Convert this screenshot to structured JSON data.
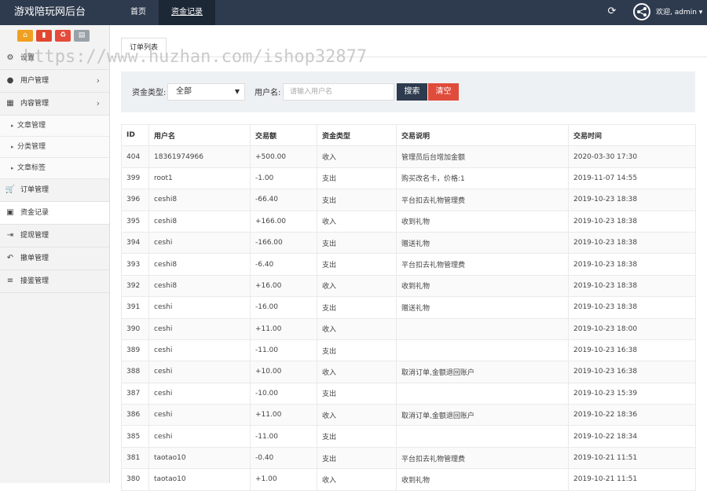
{
  "app": {
    "title": "游戏陪玩网后台"
  },
  "topnav": [
    {
      "label": "首页",
      "active": false
    },
    {
      "label": "资金记录",
      "active": true
    }
  ],
  "header": {
    "refresh_icon": "refresh-icon",
    "welcome": "欢迎, admin ▾"
  },
  "sidebar": {
    "tools": [
      {
        "icon": "home-icon",
        "color": "#f0a020"
      },
      {
        "icon": "trash-icon",
        "color": "#e04830"
      },
      {
        "icon": "recycle-icon",
        "color": "#e64a3b"
      },
      {
        "icon": "list-icon",
        "color": "#9aa2a8"
      }
    ],
    "items": [
      {
        "label": "设置",
        "icon": "gear-icon"
      },
      {
        "label": "用户管理",
        "icon": "users-icon"
      },
      {
        "label": "内容管理",
        "icon": "grid-icon"
      },
      {
        "label": "文章管理"
      },
      {
        "label": "分类管理"
      },
      {
        "label": "文章标签"
      },
      {
        "label": "订单管理",
        "icon": "cart-icon"
      },
      {
        "label": "资金记录",
        "icon": "money-icon"
      },
      {
        "label": "提现管理",
        "icon": "export-icon"
      },
      {
        "label": "撤单管理",
        "icon": "undo-icon"
      },
      {
        "label": "接鉴管理",
        "icon": "menu-icon"
      }
    ]
  },
  "watermark": "https://www.huzhan.com/ishop32877",
  "tab": {
    "label": "订单列表"
  },
  "filter": {
    "type_label": "资金类型:",
    "type_value": "全部",
    "user_label": "用户名:",
    "user_placeholder": "请输入用户名",
    "search_label": "搜索",
    "clear_label": "清空"
  },
  "table": {
    "headers": [
      "ID",
      "用户名",
      "交易额",
      "资金类型",
      "交易说明",
      "交易时间"
    ],
    "rows": [
      [
        "404",
        "18361974966",
        "+500.00",
        "收入",
        "管理员后台增加金额",
        "2020-03-30 17:30"
      ],
      [
        "399",
        "root1",
        "-1.00",
        "支出",
        "购买改名卡，价格:1",
        "2019-11-07 14:55"
      ],
      [
        "396",
        "ceshi8",
        "-66.40",
        "支出",
        "平台扣去礼物管理费",
        "2019-10-23 18:38"
      ],
      [
        "395",
        "ceshi8",
        "+166.00",
        "收入",
        "收到礼物",
        "2019-10-23 18:38"
      ],
      [
        "394",
        "ceshi",
        "-166.00",
        "支出",
        "赠送礼物",
        "2019-10-23 18:38"
      ],
      [
        "393",
        "ceshi8",
        "-6.40",
        "支出",
        "平台扣去礼物管理费",
        "2019-10-23 18:38"
      ],
      [
        "392",
        "ceshi8",
        "+16.00",
        "收入",
        "收到礼物",
        "2019-10-23 18:38"
      ],
      [
        "391",
        "ceshi",
        "-16.00",
        "支出",
        "赠送礼物",
        "2019-10-23 18:38"
      ],
      [
        "390",
        "ceshi",
        "+11.00",
        "收入",
        "",
        "2019-10-23 18:00"
      ],
      [
        "389",
        "ceshi",
        "-11.00",
        "支出",
        "",
        "2019-10-23 16:38"
      ],
      [
        "388",
        "ceshi",
        "+10.00",
        "收入",
        "取消订单,金额退回账户",
        "2019-10-23 16:38"
      ],
      [
        "387",
        "ceshi",
        "-10.00",
        "支出",
        "",
        "2019-10-23 15:39"
      ],
      [
        "386",
        "ceshi",
        "+11.00",
        "收入",
        "取消订单,金额退回账户",
        "2019-10-22 18:36"
      ],
      [
        "385",
        "ceshi",
        "-11.00",
        "支出",
        "",
        "2019-10-22 18:34"
      ],
      [
        "381",
        "taotao10",
        "-0.40",
        "支出",
        "平台扣去礼物管理费",
        "2019-10-21 11:51"
      ],
      [
        "380",
        "taotao10",
        "+1.00",
        "收入",
        "收到礼物",
        "2019-10-21 11:51"
      ]
    ]
  }
}
